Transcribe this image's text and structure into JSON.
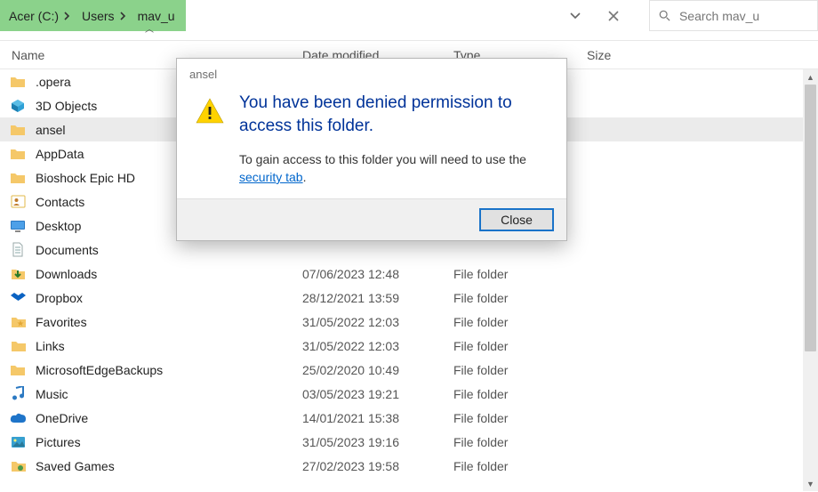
{
  "breadcrumbs": [
    "Acer (C:)",
    "Users",
    "mav_u"
  ],
  "search": {
    "placeholder": "Search mav_u"
  },
  "headers": {
    "name": "Name",
    "date": "Date modified",
    "type": "Type",
    "size": "Size"
  },
  "dialog": {
    "title": "ansel",
    "heading": "You have been denied permission to access this folder.",
    "body_pre": "To gain access to this folder you will need to use the ",
    "body_link": "security tab",
    "body_post": ".",
    "close": "Close"
  },
  "rows": [
    {
      "name": ".opera",
      "date": "",
      "type": "",
      "icon": "folder"
    },
    {
      "name": "3D Objects",
      "date": "",
      "type": "",
      "icon": "3d"
    },
    {
      "name": "ansel",
      "date": "",
      "type": "",
      "icon": "folder",
      "selected": true
    },
    {
      "name": "AppData",
      "date": "",
      "type": "",
      "icon": "folder"
    },
    {
      "name": "Bioshock Epic HD",
      "date": "",
      "type": "",
      "icon": "folder"
    },
    {
      "name": "Contacts",
      "date": "",
      "type": "",
      "icon": "contacts"
    },
    {
      "name": "Desktop",
      "date": "",
      "type": "",
      "icon": "desktop"
    },
    {
      "name": "Documents",
      "date": "",
      "type": "",
      "icon": "documents"
    },
    {
      "name": "Downloads",
      "date": "07/06/2023 12:48",
      "type": "File folder",
      "icon": "downloads"
    },
    {
      "name": "Dropbox",
      "date": "28/12/2021 13:59",
      "type": "File folder",
      "icon": "dropbox"
    },
    {
      "name": "Favorites",
      "date": "31/05/2022 12:03",
      "type": "File folder",
      "icon": "favorites"
    },
    {
      "name": "Links",
      "date": "31/05/2022 12:03",
      "type": "File folder",
      "icon": "links"
    },
    {
      "name": "MicrosoftEdgeBackups",
      "date": "25/02/2020 10:49",
      "type": "File folder",
      "icon": "folder"
    },
    {
      "name": "Music",
      "date": "03/05/2023 19:21",
      "type": "File folder",
      "icon": "music"
    },
    {
      "name": "OneDrive",
      "date": "14/01/2021 15:38",
      "type": "File folder",
      "icon": "onedrive"
    },
    {
      "name": "Pictures",
      "date": "31/05/2023 19:16",
      "type": "File folder",
      "icon": "pictures"
    },
    {
      "name": "Saved Games",
      "date": "27/02/2023 19:58",
      "type": "File folder",
      "icon": "savedgames"
    }
  ]
}
